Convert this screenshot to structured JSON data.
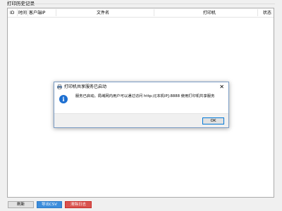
{
  "history": {
    "group_title": "打印历史记录",
    "columns": {
      "id": "ID",
      "time": "时间",
      "client_ip": "客户端IP",
      "file_name": "文件名",
      "printer": "打印机",
      "status": "状态"
    },
    "rows": []
  },
  "buttons": {
    "refresh": "刷新",
    "export_csv": "导出CSV",
    "clear_log": "清除日志"
  },
  "dialog": {
    "title": "打印机共享服务已启动",
    "message": "服务已启动。局域网内用户可以通过访问 http://[本机IP]:8888 使用打印机共享服务",
    "ok_label": "OK",
    "close_glyph": "✕",
    "info_glyph": "i",
    "icon_name": "printer-icon",
    "info_icon_name": "info-icon"
  },
  "colors": {
    "export_button": "#3c8ddc",
    "clear_button": "#d9534f",
    "info_icon": "#1d6fd1"
  }
}
